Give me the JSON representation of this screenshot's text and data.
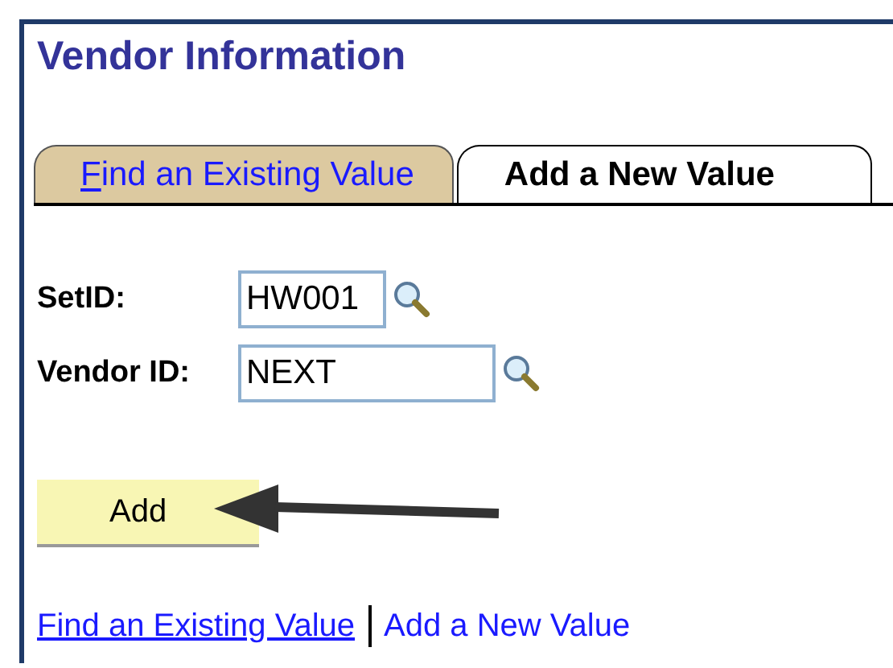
{
  "title": "Vendor Information",
  "tabs": [
    {
      "label": "Find an Existing Value",
      "selected": false
    },
    {
      "label": "Add a New Value",
      "selected": true
    }
  ],
  "fields": [
    {
      "label": "SetID:",
      "value": "HW001"
    },
    {
      "label": "Vendor ID:",
      "value": "NEXT"
    }
  ],
  "add_button": "Add",
  "footer_links": [
    {
      "label": "Find an Existing Value",
      "selected": false
    },
    {
      "label": "Add a New Value",
      "selected": true
    }
  ]
}
